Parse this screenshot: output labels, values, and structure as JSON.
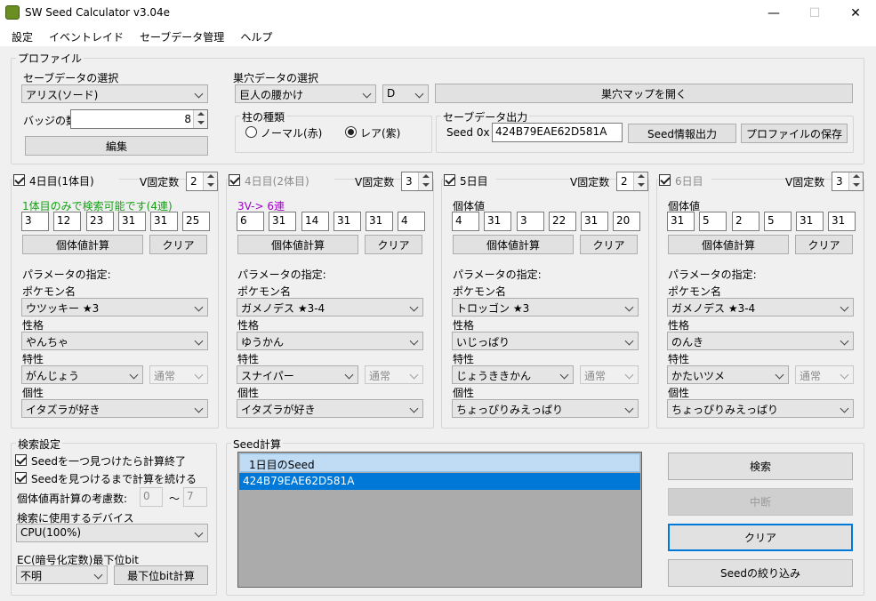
{
  "window": {
    "title": "SW Seed Calculator v3.04e",
    "minimize": "—",
    "maximize": "☐",
    "close": "✕"
  },
  "menu": [
    "設定",
    "イベントレイド",
    "セーブデータ管理",
    "ヘルプ"
  ],
  "profile": {
    "group_label": "プロファイル",
    "save_select_label": "セーブデータの選択",
    "save_select_value": "アリス(ソード)",
    "badges_label": "バッジの数",
    "badges_value": "8",
    "edit_button": "編集",
    "den_label": "巣穴データの選択",
    "den_value": "巨人の腰かけ",
    "den_rank": "D",
    "den_map_button": "巣穴マップを開く",
    "pillar_label": "柱の種類",
    "pillar_normal": "ノーマル(赤)",
    "pillar_rare": "レア(紫)",
    "pillar_selected": "rare",
    "save_output_label": "セーブデータ出力",
    "seed_label": "Seed 0x",
    "seed_value": "424B79EAE62D581A",
    "seed_info_button": "Seed情報出力",
    "save_profile_button": "プロファイルの保存"
  },
  "panels": [
    {
      "title": "4日目(1体目)",
      "enabled": true,
      "checked": true,
      "vfix_label": "V固定数",
      "vfix": "2",
      "info": "1体目のみで検索可能です(4連)",
      "info_color": "green",
      "ivs": [
        "3",
        "12",
        "23",
        "31",
        "31",
        "25"
      ],
      "calc_button": "個体値計算",
      "clear_button": "クリア",
      "param_label": "パラメータの指定:",
      "pokemon_label": "ポケモン名",
      "pokemon": "ウツッキー ★3",
      "nature_label": "性格",
      "nature": "やんちゃ",
      "ability_label": "特性",
      "ability": "がんじょう",
      "ability_type": "通常",
      "char_label": "個性",
      "characteristic": "イタズラが好き"
    },
    {
      "title": "4日目(2体目)",
      "enabled": false,
      "checked": true,
      "vfix_label": "V固定数",
      "vfix": "3",
      "info": "3V-> 6連",
      "info_color": "purple",
      "ivs": [
        "6",
        "31",
        "14",
        "31",
        "31",
        "4"
      ],
      "calc_button": "個体値計算",
      "clear_button": "クリア",
      "param_label": "パラメータの指定:",
      "pokemon_label": "ポケモン名",
      "pokemon": "ガメノデス ★3-4",
      "nature_label": "性格",
      "nature": "ゆうかん",
      "ability_label": "特性",
      "ability": "スナイパー",
      "ability_type": "通常",
      "char_label": "個性",
      "characteristic": "イタズラが好き"
    },
    {
      "title": "5日目",
      "enabled": true,
      "checked": true,
      "vfix_label": "V固定数",
      "vfix": "2",
      "info": "個体値",
      "info_color": "black",
      "ivs": [
        "4",
        "31",
        "3",
        "22",
        "31",
        "20"
      ],
      "calc_button": "個体値計算",
      "clear_button": "クリア",
      "param_label": "パラメータの指定:",
      "pokemon_label": "ポケモン名",
      "pokemon": "トロッゴン ★3",
      "nature_label": "性格",
      "nature": "いじっぱり",
      "ability_label": "特性",
      "ability": "じょうききかん",
      "ability_type": "通常",
      "char_label": "個性",
      "characteristic": "ちょっぴりみえっぱり"
    },
    {
      "title": "6日目",
      "enabled": false,
      "checked": true,
      "vfix_label": "V固定数",
      "vfix": "3",
      "info": "個体値",
      "info_color": "black",
      "ivs": [
        "31",
        "5",
        "2",
        "5",
        "31",
        "31"
      ],
      "calc_button": "個体値計算",
      "clear_button": "クリア",
      "param_label": "パラメータの指定:",
      "pokemon_label": "ポケモン名",
      "pokemon": "ガメノデス ★3-4",
      "nature_label": "性格",
      "nature": "のんき",
      "ability_label": "特性",
      "ability": "かたいツメ",
      "ability_type": "通常",
      "char_label": "個性",
      "characteristic": "ちょっぴりみえっぱり"
    }
  ],
  "search": {
    "group_label": "検索設定",
    "stop_on_first": "Seedを一つ見つけたら計算終了",
    "continue_until_found": "Seedを見つけるまで計算を続ける",
    "reconsider_label": "個体値再計算の考慮数:",
    "reconsider_min": "0",
    "tilde": "～",
    "reconsider_max": "7",
    "device_label": "検索に使用するデバイス",
    "device": "CPU(100%)",
    "ec_label": "EC(暗号化定数)最下位bit",
    "ec_value": "不明",
    "ec_button": "最下位bit計算"
  },
  "seedcalc": {
    "group_label": "Seed計算",
    "column_header": "1日目のSeed",
    "rows": [
      "424B79EAE62D581A"
    ],
    "search_button": "検索",
    "abort_button": "中断",
    "clear_button": "クリア",
    "narrow_button": "Seedの絞り込み"
  }
}
